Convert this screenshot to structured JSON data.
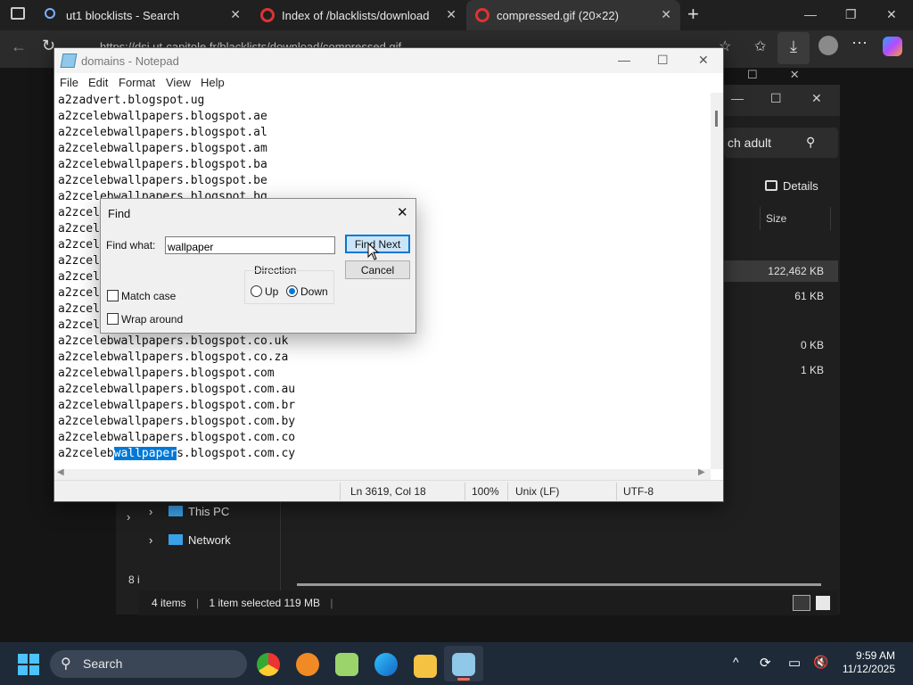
{
  "browser": {
    "tabs": [
      {
        "label": "ut1 blocklists - Search"
      },
      {
        "label": "Index of /blacklists/download"
      },
      {
        "label": "compressed.gif (20×22)"
      }
    ],
    "new_tab": "+",
    "address": "https://dsi.ut-capitole.fr/blacklists/download/compressed.gif"
  },
  "explorer": {
    "search_value": "ch adult",
    "details_label": "Details",
    "size_header": "Size",
    "sizes": [
      "122,462 KB",
      "61 KB",
      "0 KB",
      "1 KB"
    ],
    "nav": [
      "This PC",
      "Network"
    ],
    "left_count": "8 i",
    "status": {
      "items": "4 items",
      "selected": "1 item selected  119 MB"
    }
  },
  "notepad": {
    "title": "domains - Notepad",
    "menu": [
      "File",
      "Edit",
      "Format",
      "View",
      "Help"
    ],
    "lines_top": [
      "a2zadvert.blogspot.ug",
      "a2zcelebwallpapers.blogspot.ae",
      "a2zcelebwallpapers.blogspot.al",
      "a2zcelebwallpapers.blogspot.am",
      "a2zcelebwallpapers.blogspot.ba",
      "a2zcelebwallpapers.blogspot.be",
      "a2zcelebwallpapers.blogspot.bg",
      "a2zcel",
      "a2zcel",
      "a2zcel",
      "a2zcel",
      "a2zcel",
      "a2zcel",
      "a2zcel",
      "a2zcel",
      "a2zcelebwallpapers.blogspot.co.uk",
      "a2zcelebwallpapers.blogspot.co.za",
      "a2zcelebwallpapers.blogspot.com",
      "a2zcelebwallpapers.blogspot.com.au",
      "a2zcelebwallpapers.blogspot.com.br",
      "a2zcelebwallpapers.blogspot.com.by",
      "a2zcelebwallpapers.blogspot.com.co"
    ],
    "hl_line": {
      "pre": "a2zceleb",
      "sel": "wallpaper",
      "post": "s.blogspot.com.cy"
    },
    "status": {
      "pos": "Ln 3619, Col 18",
      "zoom": "100%",
      "eol": "Unix (LF)",
      "enc": "UTF-8"
    }
  },
  "find": {
    "title": "Find",
    "what_label": "Find what:",
    "what_value": "wallpaper",
    "find_next": "Find Next",
    "cancel": "Cancel",
    "direction": "Direction",
    "up": "Up",
    "down": "Down",
    "direction_selected": "Down",
    "match_case": "Match case",
    "match_case_checked": false,
    "wrap_around": "Wrap around",
    "wrap_around_checked": false
  },
  "taskbar": {
    "search": "Search",
    "time": "9:59 AM",
    "date": "11/12/2025"
  }
}
